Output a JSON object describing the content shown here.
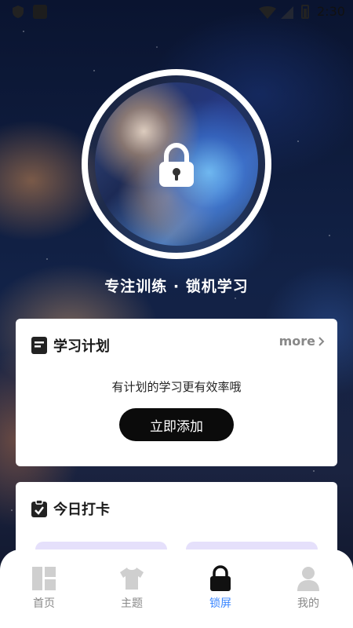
{
  "status_bar": {
    "time": "2:30",
    "icons": [
      "shield-icon",
      "app-icon",
      "wifi-icon",
      "signal-icon",
      "battery-icon"
    ]
  },
  "hero": {
    "lock_icon": "lock-icon",
    "tagline": "专注训练 · 锁机学习"
  },
  "plan_card": {
    "title": "学习计划",
    "icon": "document-icon",
    "more_label": "more",
    "empty_text": "有计划的学习更有效率哦",
    "add_button_label": "立即添加"
  },
  "checkin_card": {
    "title": "今日打卡",
    "icon": "clipboard-check-icon"
  },
  "bottom_nav": {
    "items": [
      {
        "label": "首页",
        "icon": "dashboard-icon",
        "active": false
      },
      {
        "label": "主题",
        "icon": "shirt-icon",
        "active": false
      },
      {
        "label": "锁屏",
        "icon": "lock-icon",
        "active": true
      },
      {
        "label": "我的",
        "icon": "user-icon",
        "active": false
      }
    ]
  },
  "colors": {
    "accent": "#3a86ff",
    "card_bg": "#ffffff",
    "button_bg": "#0b0b0b",
    "checkin_placeholder": "#e5e0fb"
  }
}
